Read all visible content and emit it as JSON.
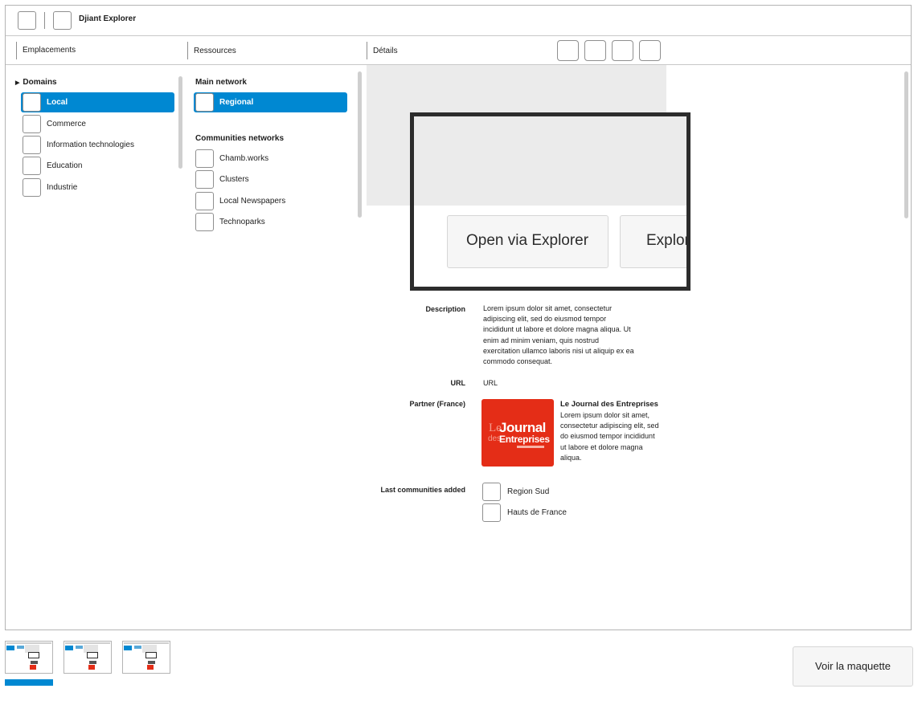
{
  "app": {
    "title": "Djiant Explorer"
  },
  "columns": {
    "locations": "Emplacements",
    "resources": "Ressources",
    "details": "Détails"
  },
  "locations": {
    "group_label": "Domains",
    "items": [
      "Local",
      "Commerce",
      "Information technologies",
      "Education",
      "Industrie"
    ],
    "selected": "Local"
  },
  "resources": {
    "main_heading": "Main network",
    "main_items": [
      "Regional"
    ],
    "communities_heading": "Communities networks",
    "community_items": [
      "Chamb.works",
      "Clusters",
      "Local Newspapers",
      "Technoparks"
    ]
  },
  "details": {
    "buttons": [
      "Open via Explorer",
      "Explor"
    ],
    "description_label": "Description",
    "description_lines": [
      "Lorem ipsum dolor sit amet, consectetur",
      "adipiscing elit, sed do eiusmod tempor",
      "incididunt ut labore et dolore magna aliqua. Ut",
      "enim ad minim veniam, quis nostrud",
      "exercitation ullamco laboris nisi ut aliquip ex ea",
      "commodo consequat."
    ],
    "url_label": "URL",
    "url_value": "URL",
    "partner_label": "Partner (France)",
    "partner_name": "Le Journal des Entreprises",
    "partner_lines": [
      "Lorem ipsum dolor sit amet,",
      "consectetur adipiscing elit, sed",
      "do eiusmod tempor incididunt",
      "ut labore et dolore magna",
      "aliqua."
    ],
    "partner_logo_text": "Le Journal des Entreprises",
    "last_label": "Last communities added",
    "last_items": [
      "Region Sud",
      "Hauts de France"
    ]
  },
  "thumbnails": {
    "count": 3,
    "active_index": 0
  },
  "footer": {
    "view_button": "Voir la maquette"
  },
  "colors": {
    "accent": "#0088d2",
    "logo_red": "#e42d17",
    "frame": "#2c2c2c"
  }
}
